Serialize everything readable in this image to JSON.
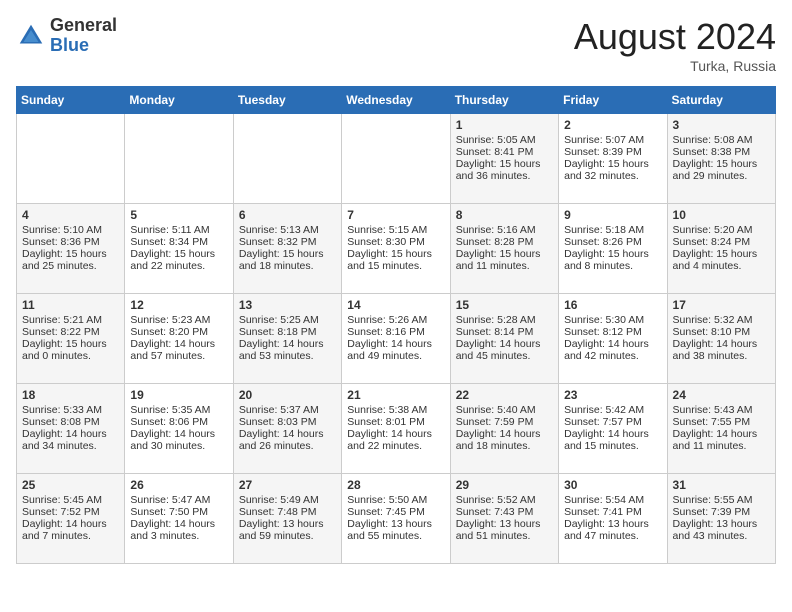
{
  "header": {
    "logo_general": "General",
    "logo_blue": "Blue",
    "month_year": "August 2024",
    "location": "Turka, Russia"
  },
  "days_of_week": [
    "Sunday",
    "Monday",
    "Tuesday",
    "Wednesday",
    "Thursday",
    "Friday",
    "Saturday"
  ],
  "weeks": [
    [
      {
        "day": "",
        "content": ""
      },
      {
        "day": "",
        "content": ""
      },
      {
        "day": "",
        "content": ""
      },
      {
        "day": "",
        "content": ""
      },
      {
        "day": "1",
        "sunrise": "Sunrise: 5:05 AM",
        "sunset": "Sunset: 8:41 PM",
        "daylight": "Daylight: 15 hours and 36 minutes."
      },
      {
        "day": "2",
        "sunrise": "Sunrise: 5:07 AM",
        "sunset": "Sunset: 8:39 PM",
        "daylight": "Daylight: 15 hours and 32 minutes."
      },
      {
        "day": "3",
        "sunrise": "Sunrise: 5:08 AM",
        "sunset": "Sunset: 8:38 PM",
        "daylight": "Daylight: 15 hours and 29 minutes."
      }
    ],
    [
      {
        "day": "4",
        "sunrise": "Sunrise: 5:10 AM",
        "sunset": "Sunset: 8:36 PM",
        "daylight": "Daylight: 15 hours and 25 minutes."
      },
      {
        "day": "5",
        "sunrise": "Sunrise: 5:11 AM",
        "sunset": "Sunset: 8:34 PM",
        "daylight": "Daylight: 15 hours and 22 minutes."
      },
      {
        "day": "6",
        "sunrise": "Sunrise: 5:13 AM",
        "sunset": "Sunset: 8:32 PM",
        "daylight": "Daylight: 15 hours and 18 minutes."
      },
      {
        "day": "7",
        "sunrise": "Sunrise: 5:15 AM",
        "sunset": "Sunset: 8:30 PM",
        "daylight": "Daylight: 15 hours and 15 minutes."
      },
      {
        "day": "8",
        "sunrise": "Sunrise: 5:16 AM",
        "sunset": "Sunset: 8:28 PM",
        "daylight": "Daylight: 15 hours and 11 minutes."
      },
      {
        "day": "9",
        "sunrise": "Sunrise: 5:18 AM",
        "sunset": "Sunset: 8:26 PM",
        "daylight": "Daylight: 15 hours and 8 minutes."
      },
      {
        "day": "10",
        "sunrise": "Sunrise: 5:20 AM",
        "sunset": "Sunset: 8:24 PM",
        "daylight": "Daylight: 15 hours and 4 minutes."
      }
    ],
    [
      {
        "day": "11",
        "sunrise": "Sunrise: 5:21 AM",
        "sunset": "Sunset: 8:22 PM",
        "daylight": "Daylight: 15 hours and 0 minutes."
      },
      {
        "day": "12",
        "sunrise": "Sunrise: 5:23 AM",
        "sunset": "Sunset: 8:20 PM",
        "daylight": "Daylight: 14 hours and 57 minutes."
      },
      {
        "day": "13",
        "sunrise": "Sunrise: 5:25 AM",
        "sunset": "Sunset: 8:18 PM",
        "daylight": "Daylight: 14 hours and 53 minutes."
      },
      {
        "day": "14",
        "sunrise": "Sunrise: 5:26 AM",
        "sunset": "Sunset: 8:16 PM",
        "daylight": "Daylight: 14 hours and 49 minutes."
      },
      {
        "day": "15",
        "sunrise": "Sunrise: 5:28 AM",
        "sunset": "Sunset: 8:14 PM",
        "daylight": "Daylight: 14 hours and 45 minutes."
      },
      {
        "day": "16",
        "sunrise": "Sunrise: 5:30 AM",
        "sunset": "Sunset: 8:12 PM",
        "daylight": "Daylight: 14 hours and 42 minutes."
      },
      {
        "day": "17",
        "sunrise": "Sunrise: 5:32 AM",
        "sunset": "Sunset: 8:10 PM",
        "daylight": "Daylight: 14 hours and 38 minutes."
      }
    ],
    [
      {
        "day": "18",
        "sunrise": "Sunrise: 5:33 AM",
        "sunset": "Sunset: 8:08 PM",
        "daylight": "Daylight: 14 hours and 34 minutes."
      },
      {
        "day": "19",
        "sunrise": "Sunrise: 5:35 AM",
        "sunset": "Sunset: 8:06 PM",
        "daylight": "Daylight: 14 hours and 30 minutes."
      },
      {
        "day": "20",
        "sunrise": "Sunrise: 5:37 AM",
        "sunset": "Sunset: 8:03 PM",
        "daylight": "Daylight: 14 hours and 26 minutes."
      },
      {
        "day": "21",
        "sunrise": "Sunrise: 5:38 AM",
        "sunset": "Sunset: 8:01 PM",
        "daylight": "Daylight: 14 hours and 22 minutes."
      },
      {
        "day": "22",
        "sunrise": "Sunrise: 5:40 AM",
        "sunset": "Sunset: 7:59 PM",
        "daylight": "Daylight: 14 hours and 18 minutes."
      },
      {
        "day": "23",
        "sunrise": "Sunrise: 5:42 AM",
        "sunset": "Sunset: 7:57 PM",
        "daylight": "Daylight: 14 hours and 15 minutes."
      },
      {
        "day": "24",
        "sunrise": "Sunrise: 5:43 AM",
        "sunset": "Sunset: 7:55 PM",
        "daylight": "Daylight: 14 hours and 11 minutes."
      }
    ],
    [
      {
        "day": "25",
        "sunrise": "Sunrise: 5:45 AM",
        "sunset": "Sunset: 7:52 PM",
        "daylight": "Daylight: 14 hours and 7 minutes."
      },
      {
        "day": "26",
        "sunrise": "Sunrise: 5:47 AM",
        "sunset": "Sunset: 7:50 PM",
        "daylight": "Daylight: 14 hours and 3 minutes."
      },
      {
        "day": "27",
        "sunrise": "Sunrise: 5:49 AM",
        "sunset": "Sunset: 7:48 PM",
        "daylight": "Daylight: 13 hours and 59 minutes."
      },
      {
        "day": "28",
        "sunrise": "Sunrise: 5:50 AM",
        "sunset": "Sunset: 7:45 PM",
        "daylight": "Daylight: 13 hours and 55 minutes."
      },
      {
        "day": "29",
        "sunrise": "Sunrise: 5:52 AM",
        "sunset": "Sunset: 7:43 PM",
        "daylight": "Daylight: 13 hours and 51 minutes."
      },
      {
        "day": "30",
        "sunrise": "Sunrise: 5:54 AM",
        "sunset": "Sunset: 7:41 PM",
        "daylight": "Daylight: 13 hours and 47 minutes."
      },
      {
        "day": "31",
        "sunrise": "Sunrise: 5:55 AM",
        "sunset": "Sunset: 7:39 PM",
        "daylight": "Daylight: 13 hours and 43 minutes."
      }
    ]
  ]
}
